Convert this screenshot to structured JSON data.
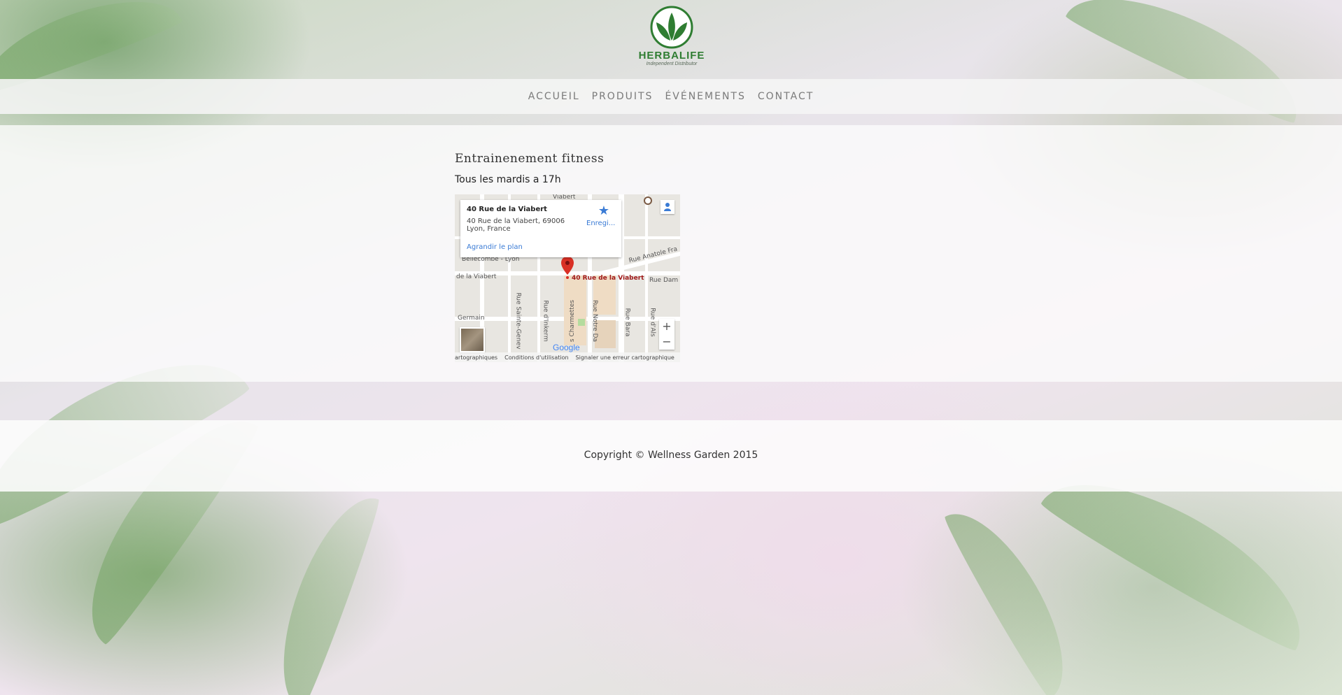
{
  "brand": {
    "name": "HERBALIFE",
    "tagline": "Independent Distributor"
  },
  "nav": {
    "items": [
      {
        "label": "ACCUEIL"
      },
      {
        "label": "PRODUITS"
      },
      {
        "label": "ÉVÉNEMENTS"
      },
      {
        "label": "CONTACT"
      }
    ]
  },
  "event": {
    "title": "Entrainenement fitness",
    "schedule": "Tous les mardis a 17h"
  },
  "map": {
    "place_name": "40 Rue de la Viabert",
    "address_line1": "40 Rue de la Viabert, 69006",
    "address_line2": "Lyon, France",
    "enlarge_link": "Agrandir le plan",
    "save_label": "Enregi...",
    "pin_label": "40 Rue de la Viabert",
    "street_labels": {
      "viabert": "de la Viabert",
      "bellecombe": "Bellecombe - Lyon",
      "anatole": "Rue Anatole Fra",
      "dame": "Rue Dam",
      "germain": "Germain",
      "sainte_genev": "Rue Sainte-Genev",
      "inkerm": "Rue d'Inkerm",
      "charmettes": "s Charmettes",
      "notre_dame": "Rue Notre Da",
      "barat": "Rue Bara",
      "als": "Rue d'Als",
      "top": "Viabert"
    },
    "google": "Google",
    "zoom_in": "+",
    "zoom_out": "−",
    "footer": {
      "data": "artographiques",
      "terms": "Conditions d'utilisation",
      "report": "Signaler une erreur cartographique"
    }
  },
  "footer": {
    "copyright": "Copyright © Wellness Garden 2015"
  },
  "colors": {
    "brand_green": "#2f7d32",
    "nav_text": "#7a7a7a",
    "link_blue": "#3a7bd5",
    "pin_red": "#d93025"
  }
}
